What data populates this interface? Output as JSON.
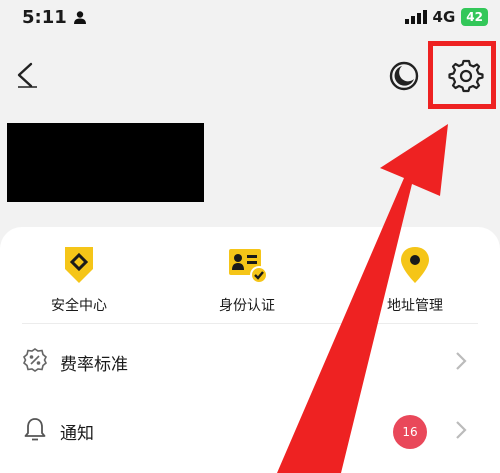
{
  "status_bar": {
    "time": "5:11",
    "network": "4G",
    "battery": "42"
  },
  "quick_actions": [
    {
      "label": "安全中心",
      "icon": "shield-diamond-icon"
    },
    {
      "label": "身份认证",
      "icon": "id-card-verified-icon"
    },
    {
      "label": "地址管理",
      "icon": "location-pin-icon"
    }
  ],
  "menu": [
    {
      "label": "费率标准",
      "icon": "rate-percent-icon"
    },
    {
      "label": "通知",
      "icon": "bell-icon",
      "badge": "16"
    }
  ],
  "colors": {
    "accent_yellow": "#f5c518",
    "highlight_red": "#ee2222",
    "badge_red": "#e9485a"
  }
}
